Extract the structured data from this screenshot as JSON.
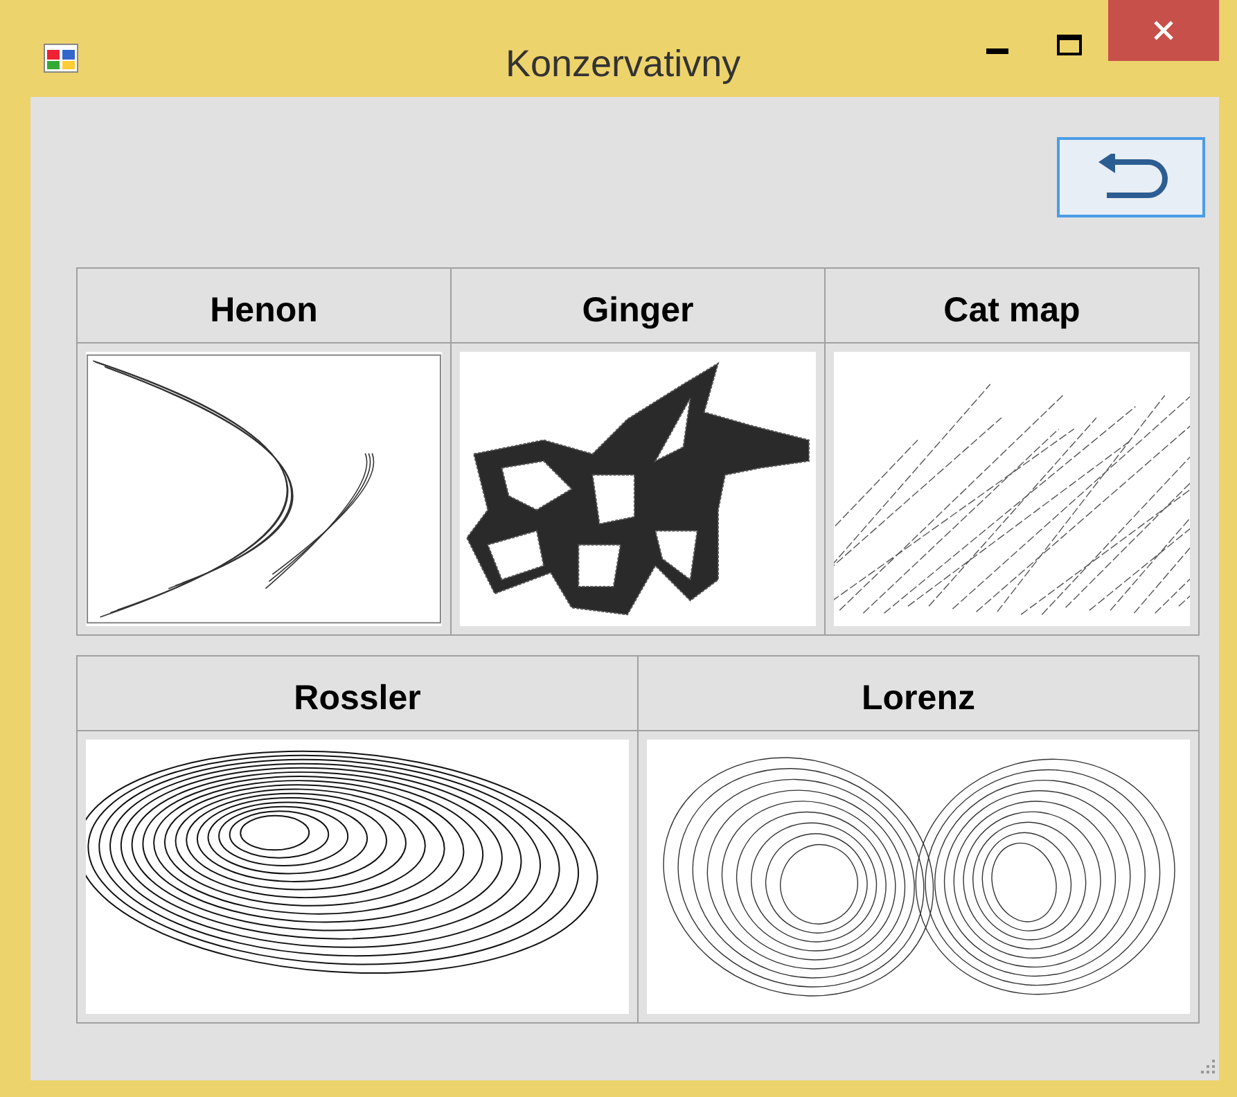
{
  "window": {
    "title": "Konzervativny"
  },
  "panels": [
    {
      "cells": [
        {
          "title": "Henon",
          "kind": "henon"
        },
        {
          "title": "Ginger",
          "kind": "ginger"
        },
        {
          "title": "Cat map",
          "kind": "catmap"
        }
      ]
    },
    {
      "cells": [
        {
          "title": "Rossler",
          "kind": "rossler"
        },
        {
          "title": "Lorenz",
          "kind": "lorenz"
        }
      ]
    }
  ]
}
